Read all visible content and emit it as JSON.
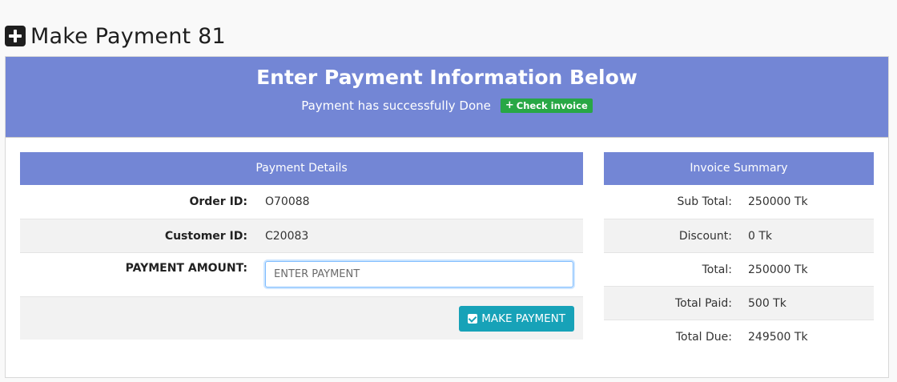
{
  "page": {
    "title": "Make Payment 81",
    "title_icon": "plus-square-icon"
  },
  "banner": {
    "heading": "Enter Payment Information Below",
    "status_message": "Payment has successfully Done",
    "check_invoice_label": "Check invoice",
    "check_invoice_icon": "plus-icon"
  },
  "payment_details": {
    "header": "Payment Details",
    "rows": [
      {
        "label": "Order ID:",
        "value": "O70088"
      },
      {
        "label": "Customer ID:",
        "value": "C20083"
      }
    ],
    "amount_label": "PAYMENT AMOUNT:",
    "amount_value": "",
    "amount_placeholder": "ENTER PAYMENT",
    "submit_label": "MAKE PAYMENT",
    "submit_icon": "check-square-icon"
  },
  "invoice_summary": {
    "header": "Invoice Summary",
    "rows": [
      {
        "label": "Sub Total:",
        "value": "250000 Tk"
      },
      {
        "label": "Discount:",
        "value": "0 Tk"
      },
      {
        "label": "Total:",
        "value": "250000 Tk"
      },
      {
        "label": "Total Paid:",
        "value": "500 Tk"
      },
      {
        "label": "Total Due:",
        "value": "249500 Tk"
      }
    ]
  },
  "colors": {
    "accent": "#7386d5",
    "success": "#28a745",
    "info": "#17a2b8",
    "focus_border": "#80bdff"
  }
}
